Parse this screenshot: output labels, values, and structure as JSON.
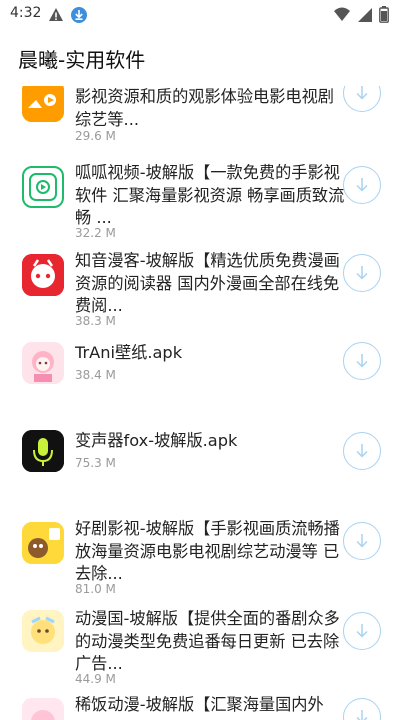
{
  "status_bar": {
    "time": "4:32",
    "icons_left": [
      "warning-icon",
      "download-icon"
    ],
    "icons_right": [
      "wifi-icon",
      "signal-icon",
      "battery-icon"
    ]
  },
  "app_bar": {
    "title": "晨曦-实用软件"
  },
  "items": [
    {
      "title": "影视资源和质的观影体验电影电视剧综艺等...",
      "size": "29.6 M",
      "icon": "video-app-icon"
    },
    {
      "title": "呱呱视频-坡解版【一款免费的手影视软件 汇聚海量影视资源 畅享画质致流畅 ...",
      "size": "32.2 M",
      "icon": "gua-gua-video-icon"
    },
    {
      "title": "知音漫客-坡解版【精选优质免费漫画资源的阅读器 国内外漫画全部在线免费阅...",
      "size": "38.3 M",
      "icon": "zhiyin-manke-icon"
    },
    {
      "title": "TrAni壁纸.apk",
      "size": "38.4 M",
      "icon": "trani-wallpaper-icon"
    },
    {
      "title": "变声器fox-坡解版.apk",
      "size": "75.3 M",
      "icon": "voice-changer-icon"
    },
    {
      "title": "好剧影视-坡解版【手影视画质流畅播放海量资源电影电视剧综艺动漫等 已去除...",
      "size": "81.0 M",
      "icon": "haoju-video-icon"
    },
    {
      "title": "动漫国-坡解版【提供全面的番剧众多的动漫类型免费追番每日更新 已去除广告...",
      "size": "44.9 M",
      "icon": "dongman-guo-icon"
    },
    {
      "title": "稀饭动漫-坡解版【汇聚海量国内外",
      "size": "",
      "icon": "xifan-dongman-icon"
    }
  ],
  "colors": {
    "accent": "#a9d3f1",
    "text": "#222222",
    "meta": "#9a9a9a"
  }
}
